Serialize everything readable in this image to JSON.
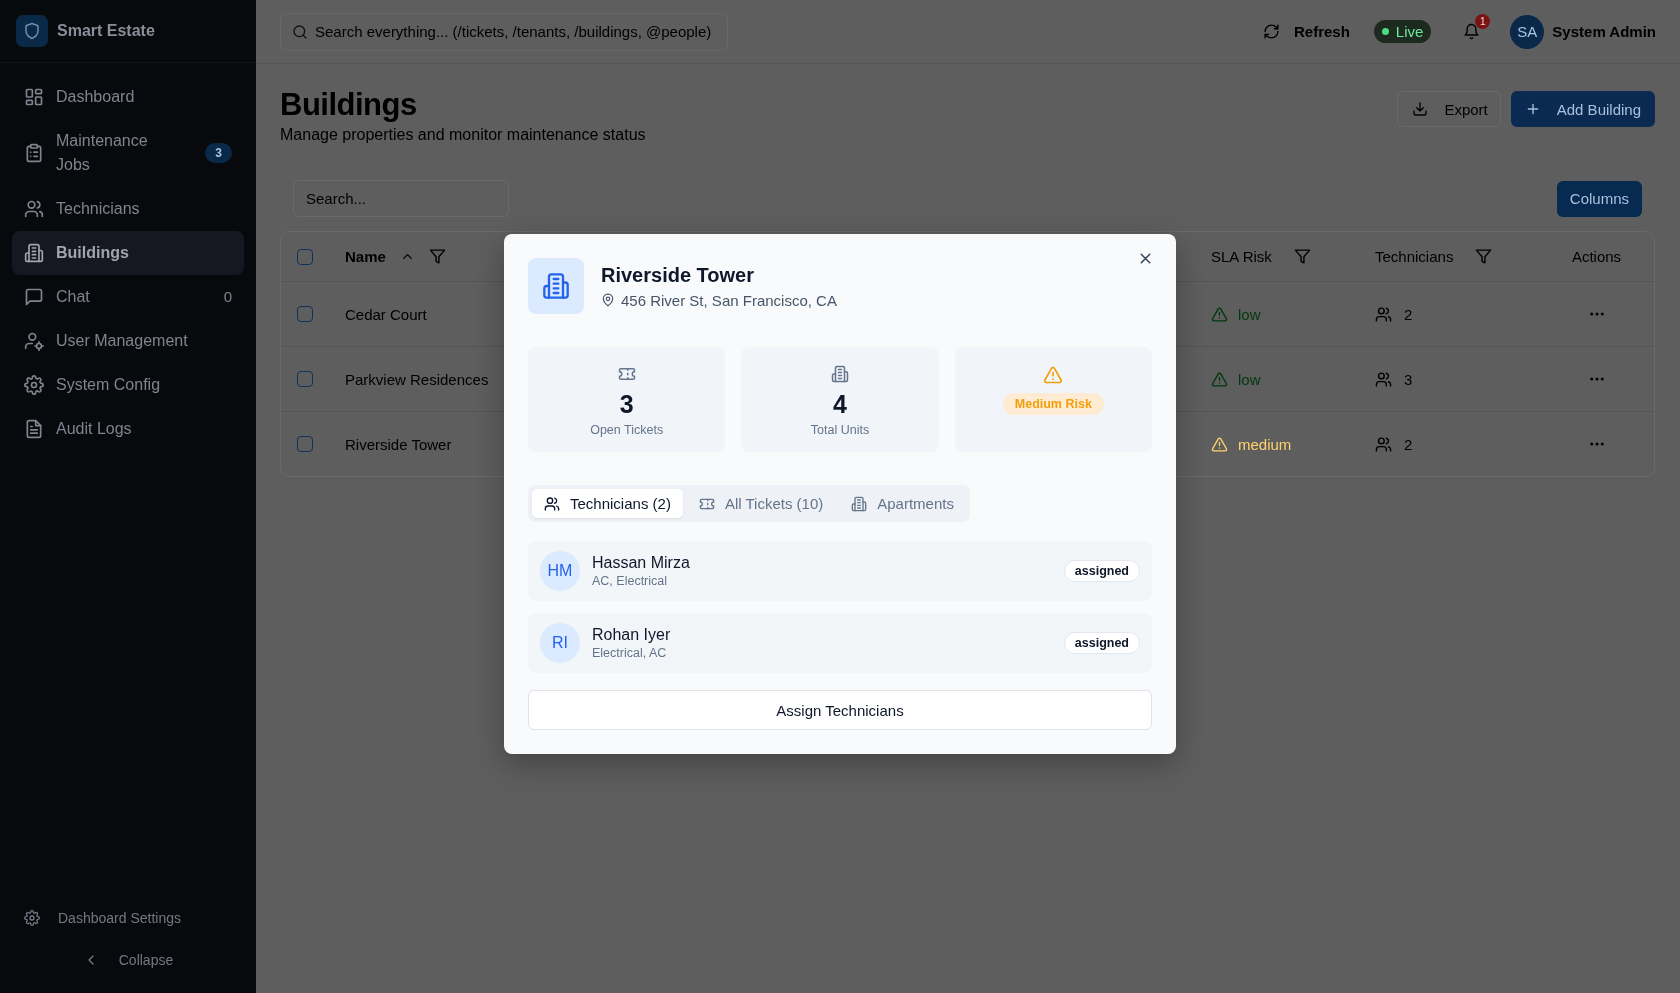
{
  "sidebar": {
    "brand": "Smart Estate",
    "items": [
      {
        "label": "Dashboard",
        "selected": false
      },
      {
        "label": "Maintenance Jobs",
        "badge": "3",
        "selected": false
      },
      {
        "label": "Technicians",
        "selected": false
      },
      {
        "label": "Buildings",
        "selected": true
      },
      {
        "label": "Chat",
        "count": "0",
        "selected": false
      },
      {
        "label": "User Management",
        "selected": false
      },
      {
        "label": "System Config",
        "selected": false
      },
      {
        "label": "Audit Logs",
        "selected": false
      }
    ],
    "footer": {
      "settings": "Dashboard Settings",
      "collapse": "Collapse"
    }
  },
  "topbar": {
    "search": {
      "placeholder": "Search everything... (/tickets, /tenants, /buildings, @people)"
    },
    "refresh": "Refresh",
    "status": "Live",
    "notifications": "1",
    "user": {
      "initials": "SA",
      "name": "System Admin"
    }
  },
  "page": {
    "title": "Buildings",
    "subtitle": "Manage properties and monitor maintenance status",
    "actions": [
      {
        "label": "Export",
        "kind": "outline"
      },
      {
        "label": "Add Building",
        "kind": "primary"
      }
    ]
  },
  "table": {
    "search": {
      "placeholder": "Search..."
    },
    "columns_button": "Columns",
    "select_all": {
      "checked": false
    },
    "columns": [
      {
        "label": "Name",
        "sort_ascending": true,
        "filter": true
      },
      {
        "label": "SLA Risk",
        "filter": true
      },
      {
        "label": "Technicians",
        "filter": true
      },
      {
        "label": "Actions",
        "filter": false
      }
    ],
    "rows": [
      {
        "checked": false,
        "name": "Cedar Court",
        "risk": {
          "label": "low",
          "color": "#003810"
        },
        "technicians": "2"
      },
      {
        "checked": false,
        "name": "Parkview Residences",
        "risk": {
          "label": "low",
          "color": "#003810"
        },
        "technicians": "3"
      },
      {
        "checked": false,
        "name": "Riverside Tower",
        "risk": {
          "label": "medium",
          "color": "#ffd36a"
        },
        "technicians": "2"
      }
    ]
  },
  "modal": {
    "title": "Riverside Tower",
    "address": "456 River St, San Francisco, CA",
    "stats": [
      {
        "kind": "count",
        "value": "3",
        "label": "Open Tickets"
      },
      {
        "kind": "count",
        "value": "4",
        "label": "Total Units"
      },
      {
        "kind": "risk",
        "label": "Medium Risk"
      }
    ],
    "tabs": [
      {
        "label": "Technicians (2)",
        "selected": true
      },
      {
        "label": "All Tickets (10)",
        "selected": false
      },
      {
        "label": "Apartments",
        "selected": false
      }
    ],
    "technicians": [
      {
        "initials": "HM",
        "name": "Hassan Mirza",
        "skills": "AC, Electrical",
        "status": "assigned"
      },
      {
        "initials": "RI",
        "name": "Rohan Iyer",
        "skills": "Electrical, AC",
        "status": "assigned"
      }
    ],
    "assign_button": "Assign Technicians"
  }
}
